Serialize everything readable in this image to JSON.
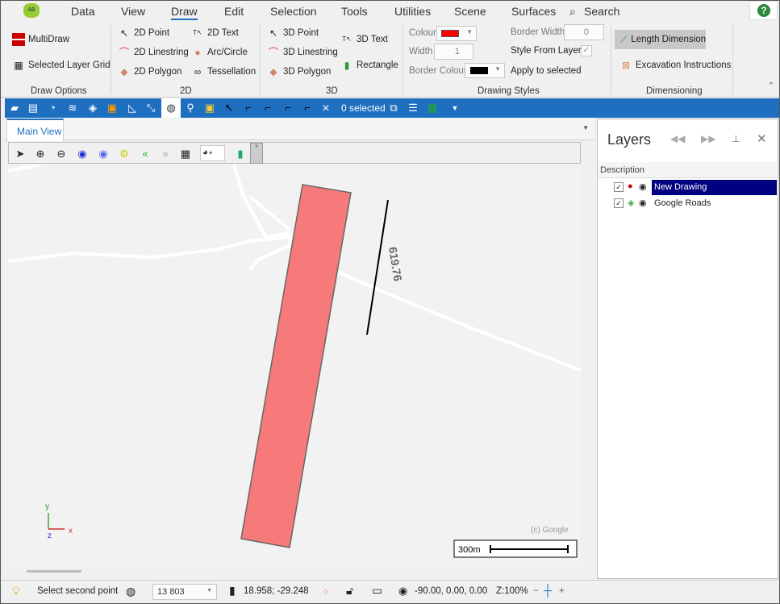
{
  "menu": {
    "items": [
      "Data",
      "View",
      "Draw",
      "Edit",
      "Selection",
      "Tools",
      "Utilities",
      "Scene",
      "Surfaces"
    ],
    "search": "Search",
    "active": "Draw"
  },
  "ribbon": {
    "draw_options": {
      "label": "Draw Options",
      "multidraw": "MultiDraw",
      "grid": "Selected Layer Grid"
    },
    "g2d": {
      "label": "2D",
      "point": "2D Point",
      "linestring": "2D Linestring",
      "polygon": "2D Polygon",
      "text": "2D Text",
      "arc": "Arc/Circle",
      "tess": "Tessellation"
    },
    "g3d": {
      "label": "3D",
      "point": "3D Point",
      "linestring": "3D Linestring",
      "polygon": "3D Polygon",
      "text": "3D Text",
      "rect": "Rectangle"
    },
    "styles": {
      "label": "Drawing Styles",
      "colour": "Colour",
      "colour_value": "#ff0000",
      "width": "Width",
      "width_value": "1",
      "border_colour": "Border Colour",
      "border_colour_value": "#000000",
      "border_width": "Border Width",
      "border_width_value": "0",
      "style_from_layer": "Style From Layer",
      "style_from_layer_checked": true,
      "apply": "Apply to selected"
    },
    "dimensioning": {
      "label": "Dimensioning",
      "length": "Length Dimension",
      "excavation": "Excavation Instructions"
    }
  },
  "toolbar": {
    "selected": "0 selected"
  },
  "tabs": [
    {
      "label": "Main View"
    }
  ],
  "map": {
    "dimension_label": "619.76",
    "copyright": "(c) Google",
    "scale": "300m",
    "axis": {
      "y": "y",
      "z": "z",
      "x": "x"
    },
    "polygon_color": "#f77a7a"
  },
  "layers": {
    "title": "Layers",
    "column": "Description",
    "items": [
      {
        "name": "New Drawing",
        "checked": true,
        "selected": true
      },
      {
        "name": "Google Roads",
        "checked": true,
        "selected": false
      }
    ]
  },
  "status": {
    "message": "Select second point",
    "scale": "13 803",
    "coords": "18.958; -29.248",
    "view": "-90.00, 0.00, 0.00",
    "zoom": "Z:100%"
  }
}
